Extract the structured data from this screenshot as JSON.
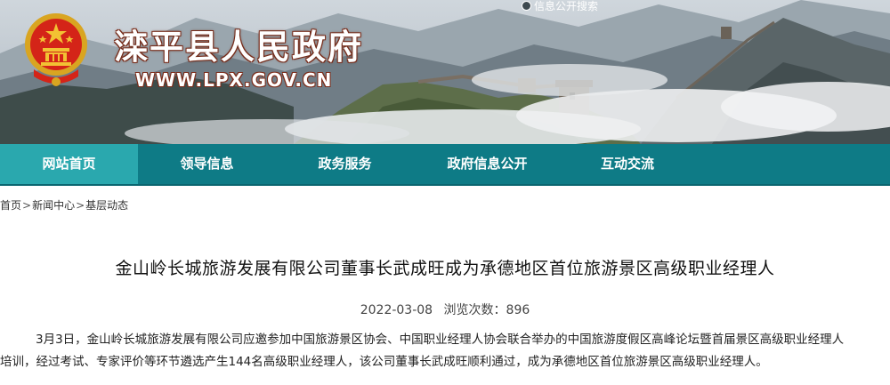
{
  "header": {
    "site_title": "滦平县人民政府",
    "site_url": "WWW.LPX.GOV.CN",
    "search_link": "信息公开搜索"
  },
  "nav": {
    "items": [
      {
        "label": "网站首页",
        "active": true
      },
      {
        "label": "领导信息",
        "active": false
      },
      {
        "label": "政务服务",
        "active": false
      },
      {
        "label": "政府信息公开",
        "active": false
      },
      {
        "label": "互动交流",
        "active": false
      }
    ]
  },
  "breadcrumb": {
    "items": [
      "首页",
      "新闻中心",
      "基层动态"
    ],
    "separator": ">"
  },
  "article": {
    "title": "金山岭长城旅游发展有限公司董事长武成旺成为承德地区首位旅游景区高级职业经理人",
    "date": "2022-03-08",
    "views_label": "浏览次数：",
    "views_count": "896",
    "paragraph_line1": "3月3日，金山岭长城旅游发展有限公司应邀参加中国旅游景区协会、中国职业经理人协会联合举办的中国旅游度假区高峰论坛暨首届景区高级职业经理人",
    "paragraph_line2": "培训，经过考试、专家评价等环节遴选产生144名高级职业经理人，该公司董事长武成旺顺利通过，成为承德地区首位旅游景区高级职业经理人。"
  },
  "colors": {
    "nav_bg": "#0e7b86",
    "nav_active": "#2aa8ae",
    "title_outline": "#7c2c1a"
  }
}
